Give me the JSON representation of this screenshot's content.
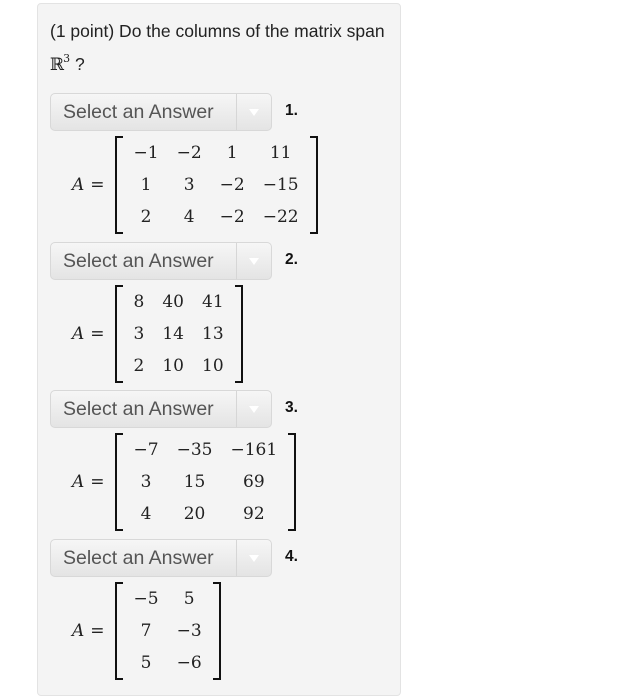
{
  "question": {
    "prefix": "(1 point) Do the columns of the matrix span ",
    "space_symbol": "ℝ",
    "space_exponent": "3",
    "suffix": "?"
  },
  "select_icon": "dropdown-triangle-icon",
  "parts": [
    {
      "select_label": "Select an Answer",
      "number": "1.",
      "lhs": "A",
      "eq": "=",
      "rows": [
        [
          "−1",
          "−2",
          "1",
          "11"
        ],
        [
          "1",
          "3",
          "−2",
          "−15"
        ],
        [
          "2",
          "4",
          "−2",
          "−22"
        ]
      ]
    },
    {
      "select_label": "Select an Answer",
      "number": "2.",
      "lhs": "A",
      "eq": "=",
      "rows": [
        [
          "8",
          "40",
          "41"
        ],
        [
          "3",
          "14",
          "13"
        ],
        [
          "2",
          "10",
          "10"
        ]
      ]
    },
    {
      "select_label": "Select an Answer",
      "number": "3.",
      "lhs": "A",
      "eq": "=",
      "rows": [
        [
          "−7",
          "−35",
          "−161"
        ],
        [
          "3",
          "15",
          "69"
        ],
        [
          "4",
          "20",
          "92"
        ]
      ]
    },
    {
      "select_label": "Select an Answer",
      "number": "4.",
      "lhs": "A",
      "eq": "=",
      "rows": [
        [
          "−5",
          "5"
        ],
        [
          "7",
          "−3"
        ],
        [
          "5",
          "−6"
        ]
      ]
    }
  ]
}
